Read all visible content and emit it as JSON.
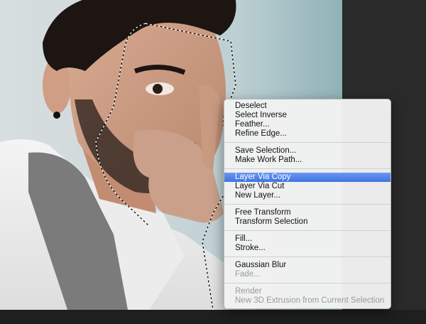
{
  "context_menu": {
    "groups": [
      [
        {
          "label": "Deselect",
          "state": "enabled"
        },
        {
          "label": "Select Inverse",
          "state": "enabled"
        },
        {
          "label": "Feather...",
          "state": "enabled"
        },
        {
          "label": "Refine Edge...",
          "state": "enabled"
        }
      ],
      [
        {
          "label": "Save Selection...",
          "state": "enabled"
        },
        {
          "label": "Make Work Path...",
          "state": "enabled"
        }
      ],
      [
        {
          "label": "Layer Via Copy",
          "state": "highlighted"
        },
        {
          "label": "Layer Via Cut",
          "state": "enabled"
        },
        {
          "label": "New Layer...",
          "state": "enabled"
        }
      ],
      [
        {
          "label": "Free Transform",
          "state": "enabled"
        },
        {
          "label": "Transform Selection",
          "state": "enabled"
        }
      ],
      [
        {
          "label": "Fill...",
          "state": "enabled"
        },
        {
          "label": "Stroke...",
          "state": "enabled"
        }
      ],
      [
        {
          "label": "Gaussian Blur",
          "state": "enabled"
        },
        {
          "label": "Fade...",
          "state": "disabled"
        }
      ],
      [
        {
          "label": "Render",
          "state": "disabled"
        },
        {
          "label": "New 3D Extrusion from Current Selection",
          "state": "disabled"
        }
      ]
    ],
    "highlight_color": "#4a7fe6"
  },
  "canvas": {
    "subject": "portrait-photo",
    "selection": "lasso-marching-ants"
  }
}
